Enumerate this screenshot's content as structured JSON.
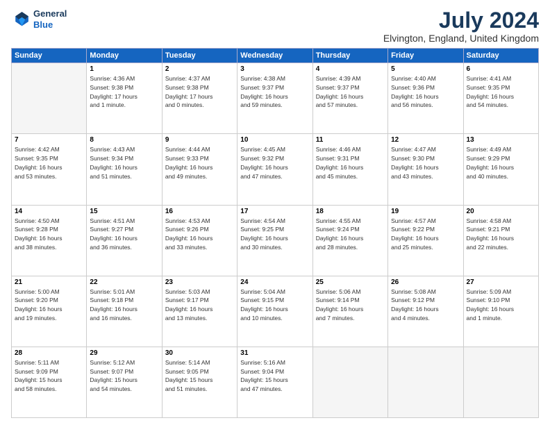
{
  "logo": {
    "line1": "General",
    "line2": "Blue"
  },
  "title": "July 2024",
  "subtitle": "Elvington, England, United Kingdom",
  "days": [
    "Sunday",
    "Monday",
    "Tuesday",
    "Wednesday",
    "Thursday",
    "Friday",
    "Saturday"
  ],
  "weeks": [
    [
      {
        "date": "",
        "info": ""
      },
      {
        "date": "1",
        "info": "Sunrise: 4:36 AM\nSunset: 9:38 PM\nDaylight: 17 hours\nand 1 minute."
      },
      {
        "date": "2",
        "info": "Sunrise: 4:37 AM\nSunset: 9:38 PM\nDaylight: 17 hours\nand 0 minutes."
      },
      {
        "date": "3",
        "info": "Sunrise: 4:38 AM\nSunset: 9:37 PM\nDaylight: 16 hours\nand 59 minutes."
      },
      {
        "date": "4",
        "info": "Sunrise: 4:39 AM\nSunset: 9:37 PM\nDaylight: 16 hours\nand 57 minutes."
      },
      {
        "date": "5",
        "info": "Sunrise: 4:40 AM\nSunset: 9:36 PM\nDaylight: 16 hours\nand 56 minutes."
      },
      {
        "date": "6",
        "info": "Sunrise: 4:41 AM\nSunset: 9:35 PM\nDaylight: 16 hours\nand 54 minutes."
      }
    ],
    [
      {
        "date": "7",
        "info": "Sunrise: 4:42 AM\nSunset: 9:35 PM\nDaylight: 16 hours\nand 53 minutes."
      },
      {
        "date": "8",
        "info": "Sunrise: 4:43 AM\nSunset: 9:34 PM\nDaylight: 16 hours\nand 51 minutes."
      },
      {
        "date": "9",
        "info": "Sunrise: 4:44 AM\nSunset: 9:33 PM\nDaylight: 16 hours\nand 49 minutes."
      },
      {
        "date": "10",
        "info": "Sunrise: 4:45 AM\nSunset: 9:32 PM\nDaylight: 16 hours\nand 47 minutes."
      },
      {
        "date": "11",
        "info": "Sunrise: 4:46 AM\nSunset: 9:31 PM\nDaylight: 16 hours\nand 45 minutes."
      },
      {
        "date": "12",
        "info": "Sunrise: 4:47 AM\nSunset: 9:30 PM\nDaylight: 16 hours\nand 43 minutes."
      },
      {
        "date": "13",
        "info": "Sunrise: 4:49 AM\nSunset: 9:29 PM\nDaylight: 16 hours\nand 40 minutes."
      }
    ],
    [
      {
        "date": "14",
        "info": "Sunrise: 4:50 AM\nSunset: 9:28 PM\nDaylight: 16 hours\nand 38 minutes."
      },
      {
        "date": "15",
        "info": "Sunrise: 4:51 AM\nSunset: 9:27 PM\nDaylight: 16 hours\nand 36 minutes."
      },
      {
        "date": "16",
        "info": "Sunrise: 4:53 AM\nSunset: 9:26 PM\nDaylight: 16 hours\nand 33 minutes."
      },
      {
        "date": "17",
        "info": "Sunrise: 4:54 AM\nSunset: 9:25 PM\nDaylight: 16 hours\nand 30 minutes."
      },
      {
        "date": "18",
        "info": "Sunrise: 4:55 AM\nSunset: 9:24 PM\nDaylight: 16 hours\nand 28 minutes."
      },
      {
        "date": "19",
        "info": "Sunrise: 4:57 AM\nSunset: 9:22 PM\nDaylight: 16 hours\nand 25 minutes."
      },
      {
        "date": "20",
        "info": "Sunrise: 4:58 AM\nSunset: 9:21 PM\nDaylight: 16 hours\nand 22 minutes."
      }
    ],
    [
      {
        "date": "21",
        "info": "Sunrise: 5:00 AM\nSunset: 9:20 PM\nDaylight: 16 hours\nand 19 minutes."
      },
      {
        "date": "22",
        "info": "Sunrise: 5:01 AM\nSunset: 9:18 PM\nDaylight: 16 hours\nand 16 minutes."
      },
      {
        "date": "23",
        "info": "Sunrise: 5:03 AM\nSunset: 9:17 PM\nDaylight: 16 hours\nand 13 minutes."
      },
      {
        "date": "24",
        "info": "Sunrise: 5:04 AM\nSunset: 9:15 PM\nDaylight: 16 hours\nand 10 minutes."
      },
      {
        "date": "25",
        "info": "Sunrise: 5:06 AM\nSunset: 9:14 PM\nDaylight: 16 hours\nand 7 minutes."
      },
      {
        "date": "26",
        "info": "Sunrise: 5:08 AM\nSunset: 9:12 PM\nDaylight: 16 hours\nand 4 minutes."
      },
      {
        "date": "27",
        "info": "Sunrise: 5:09 AM\nSunset: 9:10 PM\nDaylight: 16 hours\nand 1 minute."
      }
    ],
    [
      {
        "date": "28",
        "info": "Sunrise: 5:11 AM\nSunset: 9:09 PM\nDaylight: 15 hours\nand 58 minutes."
      },
      {
        "date": "29",
        "info": "Sunrise: 5:12 AM\nSunset: 9:07 PM\nDaylight: 15 hours\nand 54 minutes."
      },
      {
        "date": "30",
        "info": "Sunrise: 5:14 AM\nSunset: 9:05 PM\nDaylight: 15 hours\nand 51 minutes."
      },
      {
        "date": "31",
        "info": "Sunrise: 5:16 AM\nSunset: 9:04 PM\nDaylight: 15 hours\nand 47 minutes."
      },
      {
        "date": "",
        "info": ""
      },
      {
        "date": "",
        "info": ""
      },
      {
        "date": "",
        "info": ""
      }
    ]
  ]
}
